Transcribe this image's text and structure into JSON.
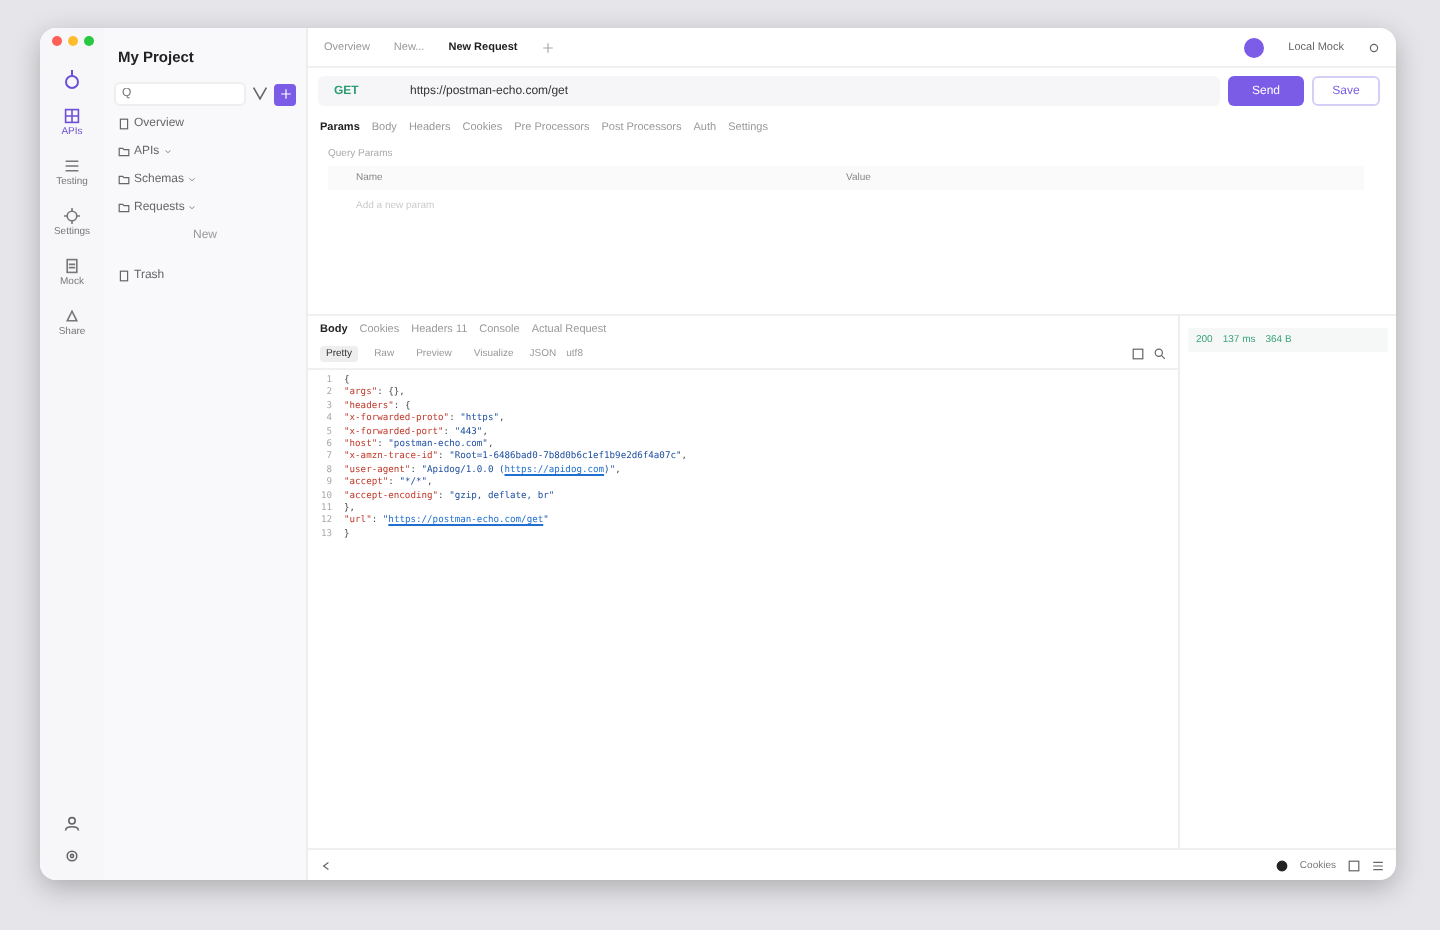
{
  "rail": [
    {
      "label": "APIs",
      "selected": true
    },
    {
      "label": "Testing",
      "selected": false
    },
    {
      "label": "Settings",
      "selected": false
    },
    {
      "label": "Mock",
      "selected": false
    },
    {
      "label": "Share",
      "selected": false
    }
  ],
  "sidebar": {
    "project": "My Project",
    "search": {
      "placeholder": "Q"
    },
    "items": [
      {
        "label": "Overview",
        "kind": "plain"
      },
      {
        "label": "APIs",
        "kind": "folder"
      },
      {
        "label": "Schemas",
        "kind": "folder"
      },
      {
        "label": "Requests",
        "kind": "folder"
      },
      {
        "label": "New",
        "kind": "hint"
      },
      {
        "label": "Trash",
        "kind": "plain"
      }
    ]
  },
  "tabs": [
    {
      "label": "Overview",
      "selected": false
    },
    {
      "label": "New...",
      "selected": false
    },
    {
      "label": "New Request",
      "selected": true
    }
  ],
  "environment": "Local Mock",
  "request": {
    "method": "GET",
    "url": "https://postman-echo.com/get",
    "send": "Send",
    "save": "Save"
  },
  "request_tabs": [
    {
      "label": "Params",
      "selected": true
    },
    {
      "label": "Body",
      "selected": false
    },
    {
      "label": "Headers",
      "selected": false
    },
    {
      "label": "Cookies",
      "selected": false
    },
    {
      "label": "Pre Processors",
      "selected": false
    },
    {
      "label": "Post Processors",
      "selected": false
    },
    {
      "label": "Auth",
      "selected": false
    },
    {
      "label": "Settings",
      "selected": false
    }
  ],
  "params": {
    "title": "Query Params",
    "columns": [
      "Name",
      "Value"
    ],
    "placeholder": "Add a new param"
  },
  "response_tabs": [
    {
      "label": "Body",
      "selected": true
    },
    {
      "label": "Cookies",
      "selected": false
    },
    {
      "label": "Headers 11",
      "selected": false
    },
    {
      "label": "Console",
      "selected": false
    },
    {
      "label": "Actual Request",
      "selected": false
    }
  ],
  "view_tabs": [
    {
      "label": "Pretty",
      "selected": true
    },
    {
      "label": "Raw",
      "selected": false
    },
    {
      "label": "Preview",
      "selected": false
    },
    {
      "label": "Visualize",
      "selected": false
    }
  ],
  "format": "JSON",
  "encoding": "utf8",
  "line_numbers": [
    "1",
    "2",
    "3",
    "4",
    "5",
    "6",
    "7",
    "8",
    "9",
    "10",
    "11",
    "12",
    "13"
  ],
  "code": [
    [
      {
        "kind": "punct",
        "text": "{"
      }
    ],
    [
      {
        "kind": "key",
        "text": "  \"args\""
      },
      {
        "kind": "punct",
        "text": ": {},"
      }
    ],
    [
      {
        "kind": "key",
        "text": "  \"headers\""
      },
      {
        "kind": "punct",
        "text": ": {"
      }
    ],
    [
      {
        "kind": "key",
        "text": "    \"x-forwarded-proto\""
      },
      {
        "kind": "punct",
        "text": ": "
      },
      {
        "kind": "string",
        "text": "\"https\""
      },
      {
        "kind": "punct",
        "text": ","
      }
    ],
    [
      {
        "kind": "key",
        "text": "    \"x-forwarded-port\""
      },
      {
        "kind": "punct",
        "text": ": "
      },
      {
        "kind": "string",
        "text": "\"443\""
      },
      {
        "kind": "punct",
        "text": ","
      }
    ],
    [
      {
        "kind": "key",
        "text": "    \"host\""
      },
      {
        "kind": "punct",
        "text": ": "
      },
      {
        "kind": "string",
        "text": "\"postman-echo.com\""
      },
      {
        "kind": "punct",
        "text": ","
      }
    ],
    [
      {
        "kind": "key",
        "text": "    \"x-amzn-trace-id\""
      },
      {
        "kind": "punct",
        "text": ": "
      },
      {
        "kind": "string",
        "text": "\"Root=1-6486bad0-7b8d0b6c1ef1b9e2d6f4a07c\""
      },
      {
        "kind": "punct",
        "text": ","
      }
    ],
    [
      {
        "kind": "key",
        "text": "    \"user-agent\""
      },
      {
        "kind": "punct",
        "text": ": "
      },
      {
        "kind": "string",
        "text": "\"Apidog/1.0.0 ("
      },
      {
        "kind": "link",
        "text": "https://apidog.com"
      },
      {
        "kind": "string",
        "text": ")\""
      },
      {
        "kind": "punct",
        "text": ","
      }
    ],
    [
      {
        "kind": "key",
        "text": "    \"accept\""
      },
      {
        "kind": "punct",
        "text": ": "
      },
      {
        "kind": "string",
        "text": "\"*/*\""
      },
      {
        "kind": "punct",
        "text": ","
      }
    ],
    [
      {
        "kind": "key",
        "text": "    \"accept-encoding\""
      },
      {
        "kind": "punct",
        "text": ": "
      },
      {
        "kind": "string",
        "text": "\"gzip, deflate, br\""
      }
    ],
    [
      {
        "kind": "punct",
        "text": "  },"
      }
    ],
    [
      {
        "kind": "key",
        "text": "  \"url\""
      },
      {
        "kind": "punct",
        "text": ": "
      },
      {
        "kind": "string",
        "text": "\""
      },
      {
        "kind": "link",
        "text": "https://postman-echo.com/get"
      },
      {
        "kind": "string",
        "text": "\""
      }
    ],
    [
      {
        "kind": "punct",
        "text": "}"
      }
    ]
  ],
  "status": {
    "code": "200",
    "time": "137 ms",
    "size": "364 B"
  },
  "footer": {
    "cookies": "Cookies"
  }
}
